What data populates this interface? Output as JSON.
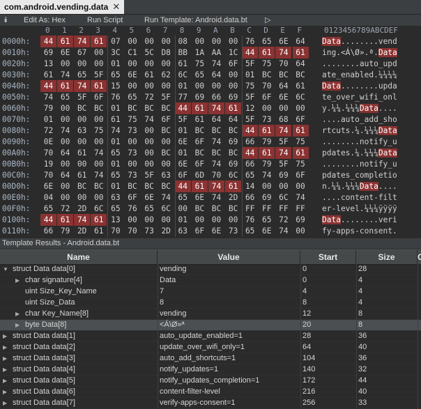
{
  "tab": {
    "title": "com.android.vending.data",
    "close_icon": "✕"
  },
  "toolbar": {
    "collapse_icon": "⯯",
    "edit_as": "Edit As: Hex",
    "run_script": "Run Script",
    "run_template": "Run Template: Android.data.bt",
    "play_icon": "▷"
  },
  "hex_columns": [
    "0",
    "1",
    "2",
    "3",
    "4",
    "5",
    "6",
    "7",
    "8",
    "9",
    "A",
    "B",
    "C",
    "D",
    "E",
    "F"
  ],
  "ascii_header": "0123456789ABCDEF",
  "hex_rows": [
    {
      "addr": "0000h:",
      "bytes": [
        "44",
        "61",
        "74",
        "61",
        "07",
        "00",
        "00",
        "00",
        "08",
        "00",
        "00",
        "00",
        "76",
        "65",
        "6E",
        "64"
      ],
      "hl": [
        0,
        1,
        2,
        3
      ],
      "ascii": [
        [
          "Data",
          true
        ],
        [
          "........vend",
          false
        ]
      ]
    },
    {
      "addr": "0010h:",
      "bytes": [
        "69",
        "6E",
        "67",
        "00",
        "3C",
        "C1",
        "5C",
        "D8",
        "BB",
        "1A",
        "AA",
        "1C",
        "44",
        "61",
        "74",
        "61"
      ],
      "hl": [
        12,
        13,
        14,
        15
      ],
      "ascii": [
        [
          "ing.<Á\\Ø».ª.",
          false
        ],
        [
          "Data",
          true
        ]
      ]
    },
    {
      "addr": "0020h:",
      "bytes": [
        "13",
        "00",
        "00",
        "00",
        "01",
        "00",
        "00",
        "00",
        "61",
        "75",
        "74",
        "6F",
        "5F",
        "75",
        "70",
        "64"
      ],
      "hl": [],
      "ascii": [
        [
          "........auto_upd",
          false
        ]
      ]
    },
    {
      "addr": "0030h:",
      "bytes": [
        "61",
        "74",
        "65",
        "5F",
        "65",
        "6E",
        "61",
        "62",
        "6C",
        "65",
        "64",
        "00",
        "01",
        "BC",
        "BC",
        "BC"
      ],
      "hl": [],
      "ascii": [
        [
          "ate_enabled.¼¼¼¼",
          false
        ]
      ]
    },
    {
      "addr": "0040h:",
      "bytes": [
        "44",
        "61",
        "74",
        "61",
        "15",
        "00",
        "00",
        "00",
        "01",
        "00",
        "00",
        "00",
        "75",
        "70",
        "64",
        "61"
      ],
      "hl": [
        0,
        1,
        2,
        3
      ],
      "ascii": [
        [
          "Data",
          true
        ],
        [
          "........upda",
          false
        ]
      ]
    },
    {
      "addr": "0050h:",
      "bytes": [
        "74",
        "65",
        "5F",
        "6F",
        "76",
        "65",
        "72",
        "5F",
        "77",
        "69",
        "66",
        "69",
        "5F",
        "6F",
        "6E",
        "6C"
      ],
      "hl": [],
      "ascii": [
        [
          "te_over_wifi_onl",
          false
        ]
      ]
    },
    {
      "addr": "0060h:",
      "bytes": [
        "79",
        "00",
        "BC",
        "BC",
        "01",
        "BC",
        "BC",
        "BC",
        "44",
        "61",
        "74",
        "61",
        "12",
        "00",
        "00",
        "00"
      ],
      "hl": [
        8,
        9,
        10,
        11
      ],
      "ascii": [
        [
          "y.¼¼.¼¼¼",
          false
        ],
        [
          "Data",
          true
        ],
        [
          "....",
          false
        ]
      ]
    },
    {
      "addr": "0070h:",
      "bytes": [
        "01",
        "00",
        "00",
        "00",
        "61",
        "75",
        "74",
        "6F",
        "5F",
        "61",
        "64",
        "64",
        "5F",
        "73",
        "68",
        "6F"
      ],
      "hl": [],
      "ascii": [
        [
          "....auto_add_sho",
          false
        ]
      ]
    },
    {
      "addr": "0080h:",
      "bytes": [
        "72",
        "74",
        "63",
        "75",
        "74",
        "73",
        "00",
        "BC",
        "01",
        "BC",
        "BC",
        "BC",
        "44",
        "61",
        "74",
        "61"
      ],
      "hl": [
        12,
        13,
        14,
        15
      ],
      "ascii": [
        [
          "rtcuts.¼.¼¼¼",
          false
        ],
        [
          "Data",
          true
        ]
      ]
    },
    {
      "addr": "0090h:",
      "bytes": [
        "0E",
        "00",
        "00",
        "00",
        "01",
        "00",
        "00",
        "00",
        "6E",
        "6F",
        "74",
        "69",
        "66",
        "79",
        "5F",
        "75"
      ],
      "hl": [],
      "ascii": [
        [
          "........notify_u",
          false
        ]
      ]
    },
    {
      "addr": "00A0h:",
      "bytes": [
        "70",
        "64",
        "61",
        "74",
        "65",
        "73",
        "00",
        "BC",
        "01",
        "BC",
        "BC",
        "BC",
        "44",
        "61",
        "74",
        "61"
      ],
      "hl": [
        12,
        13,
        14,
        15
      ],
      "ascii": [
        [
          "pdates.¼.¼¼¼",
          false
        ],
        [
          "Data",
          true
        ]
      ]
    },
    {
      "addr": "00B0h:",
      "bytes": [
        "19",
        "00",
        "00",
        "00",
        "01",
        "00",
        "00",
        "00",
        "6E",
        "6F",
        "74",
        "69",
        "66",
        "79",
        "5F",
        "75"
      ],
      "hl": [],
      "ascii": [
        [
          "........notify_u",
          false
        ]
      ]
    },
    {
      "addr": "00C0h:",
      "bytes": [
        "70",
        "64",
        "61",
        "74",
        "65",
        "73",
        "5F",
        "63",
        "6F",
        "6D",
        "70",
        "6C",
        "65",
        "74",
        "69",
        "6F"
      ],
      "hl": [],
      "ascii": [
        [
          "pdates_completio",
          false
        ]
      ]
    },
    {
      "addr": "00D0h:",
      "bytes": [
        "6E",
        "00",
        "BC",
        "BC",
        "01",
        "BC",
        "BC",
        "BC",
        "44",
        "61",
        "74",
        "61",
        "14",
        "00",
        "00",
        "00"
      ],
      "hl": [
        8,
        9,
        10,
        11
      ],
      "ascii": [
        [
          "n.¼¼.¼¼¼",
          false
        ],
        [
          "Data",
          true
        ],
        [
          "....",
          false
        ]
      ]
    },
    {
      "addr": "00E0h:",
      "bytes": [
        "04",
        "00",
        "00",
        "00",
        "63",
        "6F",
        "6E",
        "74",
        "65",
        "6E",
        "74",
        "2D",
        "66",
        "69",
        "6C",
        "74"
      ],
      "hl": [],
      "ascii": [
        [
          "....content-filt",
          false
        ]
      ]
    },
    {
      "addr": "00F0h:",
      "bytes": [
        "65",
        "72",
        "2D",
        "6C",
        "65",
        "76",
        "65",
        "6C",
        "00",
        "BC",
        "BC",
        "BC",
        "FF",
        "FF",
        "FF",
        "FF"
      ],
      "hl": [],
      "ascii": [
        [
          "er-level.¼¼¼ÿÿÿÿ",
          false
        ]
      ]
    },
    {
      "addr": "0100h:",
      "bytes": [
        "44",
        "61",
        "74",
        "61",
        "13",
        "00",
        "00",
        "00",
        "01",
        "00",
        "00",
        "00",
        "76",
        "65",
        "72",
        "69"
      ],
      "hl": [
        0,
        1,
        2,
        3
      ],
      "ascii": [
        [
          "Data",
          true
        ],
        [
          "........veri",
          false
        ]
      ]
    },
    {
      "addr": "0110h:",
      "bytes": [
        "66",
        "79",
        "2D",
        "61",
        "70",
        "70",
        "73",
        "2D",
        "63",
        "6F",
        "6E",
        "73",
        "65",
        "6E",
        "74",
        "00"
      ],
      "hl": [],
      "ascii": [
        [
          "fy-apps-consent.",
          false
        ]
      ]
    }
  ],
  "template_results": {
    "title": "Template Results - Android.data.bt",
    "headers": {
      "name": "Name",
      "value": "Value",
      "start": "Start",
      "size": "Size",
      "extra": "C"
    },
    "rows": [
      {
        "indent": 0,
        "arrow": "▼",
        "name": "struct Data data[0]",
        "value": "vending",
        "start": "0",
        "size": "28",
        "sel": false
      },
      {
        "indent": 1,
        "arrow": "▶",
        "name": "char signature[4]",
        "value": "Data",
        "start": "0",
        "size": "4",
        "sel": false
      },
      {
        "indent": 1,
        "arrow": "",
        "name": "uint Size_Key_Name",
        "value": "7",
        "start": "4",
        "size": "4",
        "sel": false
      },
      {
        "indent": 1,
        "arrow": "",
        "name": "uint Size_Data",
        "value": "8",
        "start": "8",
        "size": "4",
        "sel": false
      },
      {
        "indent": 1,
        "arrow": "▶",
        "name": "char Key_Name[8]",
        "value": "vending",
        "start": "12",
        "size": "8",
        "sel": false
      },
      {
        "indent": 1,
        "arrow": "▶",
        "name": "byte Data[8]",
        "value": "<Á\\Ø»ª",
        "start": "20",
        "size": "8",
        "sel": true
      },
      {
        "indent": 0,
        "arrow": "▶",
        "name": "struct Data data[1]",
        "value": "auto_update_enabled=1",
        "start": "28",
        "size": "36",
        "sel": false
      },
      {
        "indent": 0,
        "arrow": "▶",
        "name": "struct Data data[2]",
        "value": "update_over_wifi_only=1",
        "start": "64",
        "size": "40",
        "sel": false
      },
      {
        "indent": 0,
        "arrow": "▶",
        "name": "struct Data data[3]",
        "value": "auto_add_shortcuts=1",
        "start": "104",
        "size": "36",
        "sel": false
      },
      {
        "indent": 0,
        "arrow": "▶",
        "name": "struct Data data[4]",
        "value": "notify_updates=1",
        "start": "140",
        "size": "32",
        "sel": false
      },
      {
        "indent": 0,
        "arrow": "▶",
        "name": "struct Data data[5]",
        "value": "notify_updates_completion=1",
        "start": "172",
        "size": "44",
        "sel": false
      },
      {
        "indent": 0,
        "arrow": "▶",
        "name": "struct Data data[6]",
        "value": "content-filter-level",
        "start": "216",
        "size": "40",
        "sel": false
      },
      {
        "indent": 0,
        "arrow": "▶",
        "name": "struct Data data[7]",
        "value": "verify-apps-consent=1",
        "start": "256",
        "size": "33",
        "sel": false
      }
    ]
  }
}
